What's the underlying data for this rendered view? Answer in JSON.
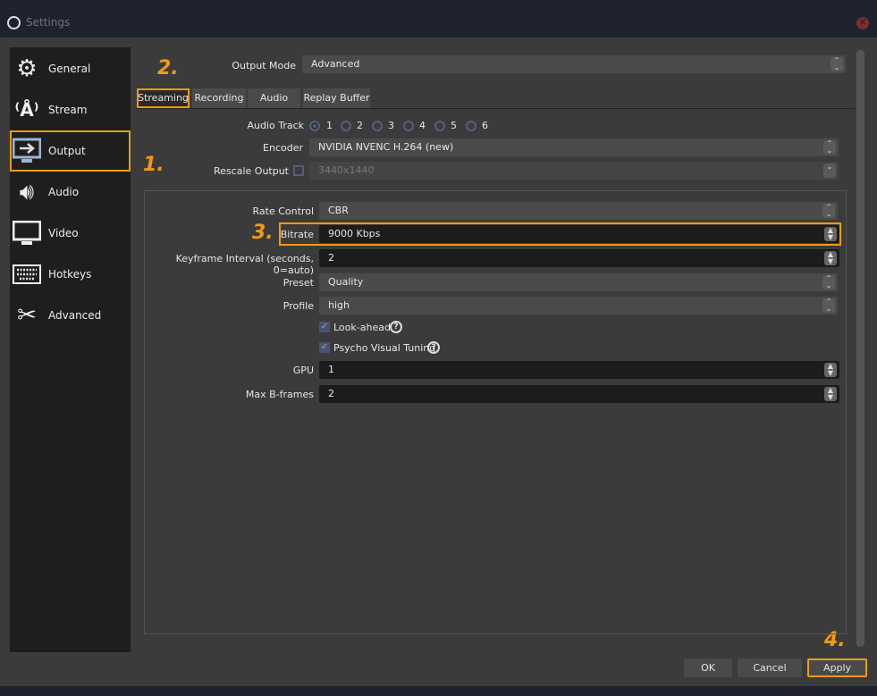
{
  "window": {
    "title": "Settings",
    "close_icon": "close-icon"
  },
  "sidebar": {
    "items": [
      {
        "label": "General",
        "icon": "gear-icon"
      },
      {
        "label": "Stream",
        "icon": "antenna-icon"
      },
      {
        "label": "Output",
        "icon": "monitor-arrow-icon",
        "selected": true
      },
      {
        "label": "Audio",
        "icon": "speaker-icon"
      },
      {
        "label": "Video",
        "icon": "monitor-icon"
      },
      {
        "label": "Hotkeys",
        "icon": "keyboard-icon"
      },
      {
        "label": "Advanced",
        "icon": "tools-icon"
      }
    ]
  },
  "output_mode": {
    "label": "Output Mode",
    "value": "Advanced"
  },
  "tabs": [
    "Streaming",
    "Recording",
    "Audio",
    "Replay Buffer"
  ],
  "active_tab": "Streaming",
  "audio_track": {
    "label": "Audio Track",
    "options": [
      "1",
      "2",
      "3",
      "4",
      "5",
      "6"
    ],
    "selected": "1"
  },
  "encoder": {
    "label": "Encoder",
    "value": "NVIDIA NVENC H.264 (new)"
  },
  "rescale": {
    "label": "Rescale Output",
    "checked": false,
    "value": "3440x1440"
  },
  "rate_control": {
    "label": "Rate Control",
    "value": "CBR"
  },
  "bitrate": {
    "label": "Bitrate",
    "value": "9000 Kbps"
  },
  "keyframe": {
    "label": "Keyframe Interval (seconds, 0=auto)",
    "value": "2"
  },
  "preset": {
    "label": "Preset",
    "value": "Quality"
  },
  "profile": {
    "label": "Profile",
    "value": "high"
  },
  "lookahead": {
    "label": "Look-ahead",
    "checked": true
  },
  "psycho": {
    "label": "Psycho Visual Tuning",
    "checked": true
  },
  "gpu": {
    "label": "GPU",
    "value": "1"
  },
  "bframes": {
    "label": "Max B-frames",
    "value": "2"
  },
  "buttons": {
    "ok": "OK",
    "cancel": "Cancel",
    "apply": "Apply"
  },
  "annotations": {
    "a1": "1.",
    "a2": "2.",
    "a3": "3.",
    "a4": "4."
  },
  "accent": "#f29a12"
}
